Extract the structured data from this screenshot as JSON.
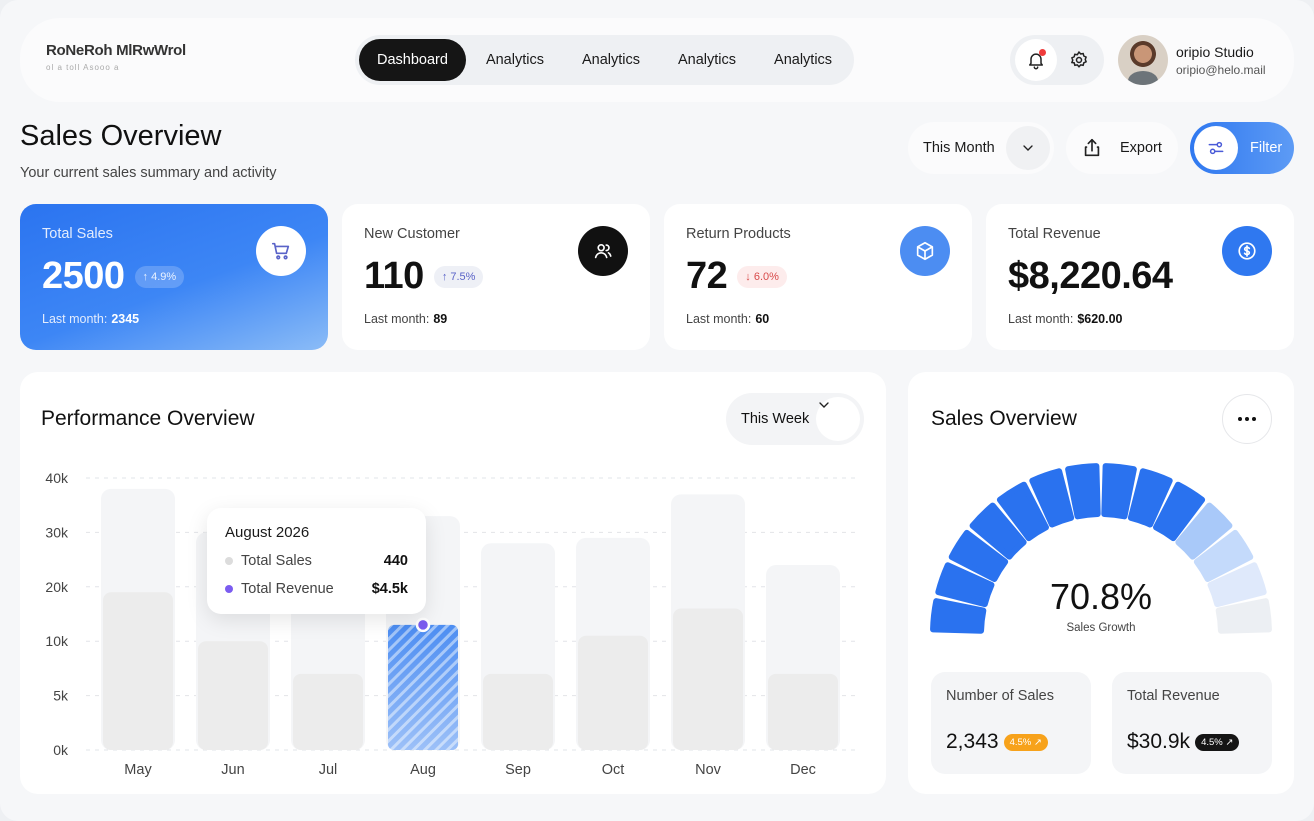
{
  "brand": {
    "logo_line1": "RoNeRoh MlRwWrol",
    "logo_line2": "ol a toll Asooo a"
  },
  "nav": [
    "Dashboard",
    "Analytics",
    "Analytics",
    "Analytics",
    "Analytics"
  ],
  "user": {
    "name": "oripio Studio",
    "email": "oripio@helo.mail"
  },
  "page": {
    "title": "Sales Overview",
    "subtitle": "Your current sales summary and activity"
  },
  "toolbar": {
    "period": "This Month",
    "export_label": "Export",
    "filter_label": "Filter"
  },
  "stats": [
    {
      "label": "Total Sales",
      "value": "2500",
      "badge": "↑ 4.9%",
      "last_label": "Last month:",
      "last_value": "2345",
      "icon": "cart-icon"
    },
    {
      "label": "New Customer",
      "value": "110",
      "badge": "↑ 7.5%",
      "last_label": "Last month:",
      "last_value": "89",
      "icon": "users-icon"
    },
    {
      "label": "Return Products",
      "value": "72",
      "badge": "↓ 6.0%",
      "last_label": "Last month:",
      "last_value": "60",
      "icon": "box-icon"
    },
    {
      "label": "Total Revenue",
      "value": "$8,220.64",
      "badge": "",
      "last_label": "Last month:",
      "last_value": "$620.00",
      "icon": "dollar-icon"
    }
  ],
  "performance": {
    "title": "Performance Overview",
    "period": "This Week",
    "tooltip": {
      "title": "August 2026",
      "rows": [
        {
          "label": "Total Sales",
          "value": "440",
          "color": "#d9d9d9"
        },
        {
          "label": "Total Revenue",
          "value": "$4.5k",
          "color": "#7b5cf0"
        }
      ]
    }
  },
  "chart_data": {
    "type": "bar",
    "categories": [
      "May",
      "Jun",
      "Jul",
      "Aug",
      "Sep",
      "Oct",
      "Nov",
      "Dec"
    ],
    "y_ticks": [
      "40k",
      "30k",
      "20k",
      "10k",
      "5k",
      "0k"
    ],
    "y_tick_values": [
      40,
      30,
      20,
      10,
      5,
      0
    ],
    "ylim": [
      0,
      42
    ],
    "series": [
      {
        "values": [
          38,
          30,
          28,
          33,
          28,
          29,
          37,
          24
        ]
      },
      {
        "values": [
          19,
          10,
          7,
          13,
          7,
          11,
          16,
          7
        ]
      }
    ],
    "highlight_index": 3,
    "grid": true
  },
  "sales_overview": {
    "title": "Sales Overview",
    "gauge_value": "70.8%",
    "gauge_label": "Sales Growth",
    "gauge_fraction": 0.708,
    "number_of_sales": {
      "label": "Number of Sales",
      "value": "2,343",
      "badge": "4.5% ↗"
    },
    "total_revenue": {
      "label": "Total Revenue",
      "value": "$30.9k",
      "badge": "4.5% ↗"
    }
  },
  "colors": {
    "accent": "#2f78f0",
    "orange": "#f7a21b",
    "dark": "#151515"
  }
}
